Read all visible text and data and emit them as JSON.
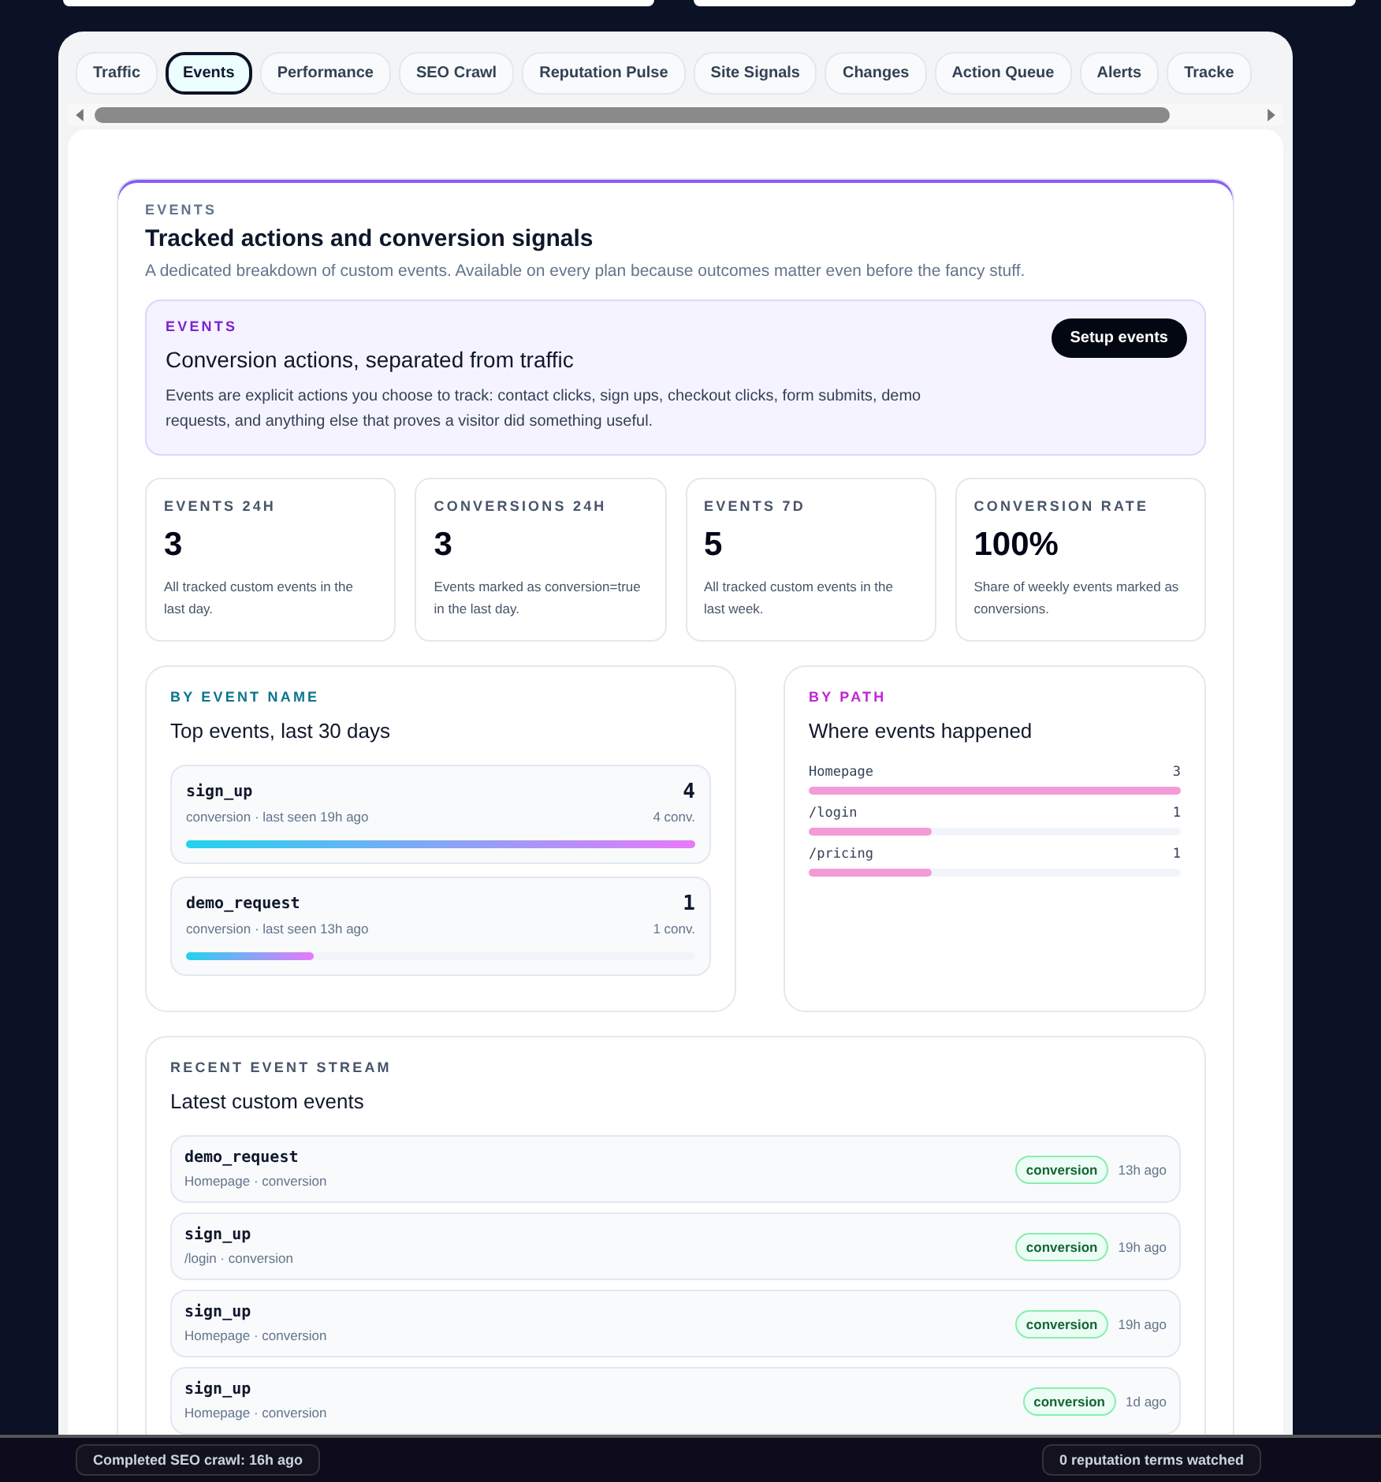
{
  "tabs": [
    {
      "label": "Traffic",
      "selected": false
    },
    {
      "label": "Events",
      "selected": true
    },
    {
      "label": "Performance",
      "selected": false
    },
    {
      "label": "SEO Crawl",
      "selected": false
    },
    {
      "label": "Reputation Pulse",
      "selected": false
    },
    {
      "label": "Site Signals",
      "selected": false
    },
    {
      "label": "Changes",
      "selected": false
    },
    {
      "label": "Action Queue",
      "selected": false
    },
    {
      "label": "Alerts",
      "selected": false
    },
    {
      "label": "Tracke",
      "selected": false
    }
  ],
  "header": {
    "eyebrow": "EVENTS",
    "title": "Tracked actions and conversion signals",
    "subtitle": "A dedicated breakdown of custom events. Available on every plan because outcomes matter even before the fancy stuff."
  },
  "callout": {
    "eyebrow": "EVENTS",
    "title": "Conversion actions, separated from traffic",
    "text": "Events are explicit actions you choose to track: contact clicks, sign ups, checkout clicks, form submits, demo requests, and anything else that proves a visitor did something useful.",
    "button": "Setup events"
  },
  "stats": [
    {
      "label": "EVENTS 24H",
      "value": "3",
      "note": "All tracked custom events in the last day."
    },
    {
      "label": "CONVERSIONS 24H",
      "value": "3",
      "note": "Events marked as conversion=true in the last day."
    },
    {
      "label": "EVENTS 7D",
      "value": "5",
      "note": "All tracked custom events in the last week."
    },
    {
      "label": "CONVERSION RATE",
      "value": "100%",
      "note": "Share of weekly events marked as conversions."
    }
  ],
  "by_event": {
    "eyebrow": "BY EVENT NAME",
    "title": "Top events, last 30 days",
    "items": [
      {
        "name": "sign_up",
        "meta": "conversion · last seen 19h ago",
        "count": "4",
        "conv": "4 conv.",
        "level": 1
      },
      {
        "name": "demo_request",
        "meta": "conversion · last seen 13h ago",
        "count": "1",
        "conv": "1 conv.",
        "level": 0.25
      }
    ]
  },
  "by_path": {
    "eyebrow": "BY PATH",
    "title": "Where events happened",
    "items": [
      {
        "path": "Homepage",
        "count": "3",
        "level": 1
      },
      {
        "path": "/login",
        "count": "1",
        "level": 0.33
      },
      {
        "path": "/pricing",
        "count": "1",
        "level": 0.33
      }
    ]
  },
  "stream": {
    "eyebrow": "RECENT EVENT STREAM",
    "title": "Latest custom events",
    "items": [
      {
        "name": "demo_request",
        "meta": "Homepage · conversion",
        "tag": "conversion",
        "time": "13h ago"
      },
      {
        "name": "sign_up",
        "meta": "/login · conversion",
        "tag": "conversion",
        "time": "19h ago"
      },
      {
        "name": "sign_up",
        "meta": "Homepage · conversion",
        "tag": "conversion",
        "time": "19h ago"
      },
      {
        "name": "sign_up",
        "meta": "Homepage · conversion",
        "tag": "conversion",
        "time": "1d ago"
      }
    ]
  },
  "status_bar": {
    "left": "Completed SEO crawl: 16h ago",
    "right": "0 reputation terms watched"
  }
}
